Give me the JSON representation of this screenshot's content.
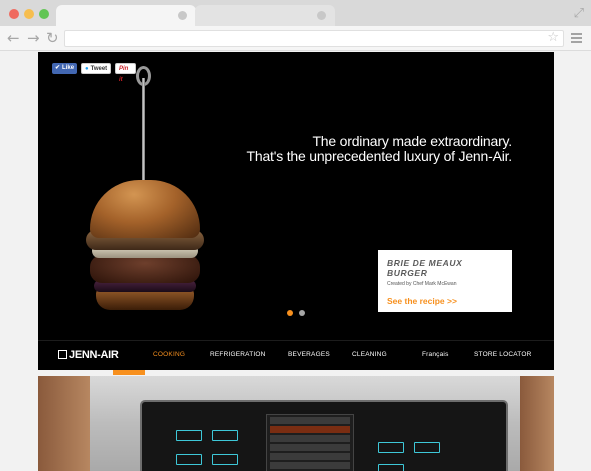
{
  "browser": {
    "back_icon": "back-arrow-icon",
    "forward_icon": "forward-arrow-icon",
    "reload_icon": "reload-icon",
    "bookmark_icon": "star-icon",
    "menu_icon": "hamburger-menu-icon",
    "resize_icon": "fullscreen-icon"
  },
  "social": {
    "like": "Like",
    "tweet": "Tweet",
    "pin": "Pin it"
  },
  "hero": {
    "tagline_line1": "The ordinary made extraordinary.",
    "tagline_line2": "That's the unprecedented luxury of Jenn-Air."
  },
  "recipe": {
    "title": "BRIE DE MEAUX BURGER",
    "author": "Created by Chef Mark McEwan",
    "link": "See the recipe >>"
  },
  "carousel": {
    "slides": 2,
    "active": 1
  },
  "nav": {
    "logo": "JENN-AIR",
    "items": [
      "COOKING",
      "REFRIGERATION",
      "BEVERAGES",
      "CLEANING",
      "Français",
      "STORE LOCATOR"
    ],
    "active": "COOKING"
  },
  "colors": {
    "accent": "#f7901e",
    "hero_bg": "#000000",
    "oven_button": "#3ec8d8"
  }
}
